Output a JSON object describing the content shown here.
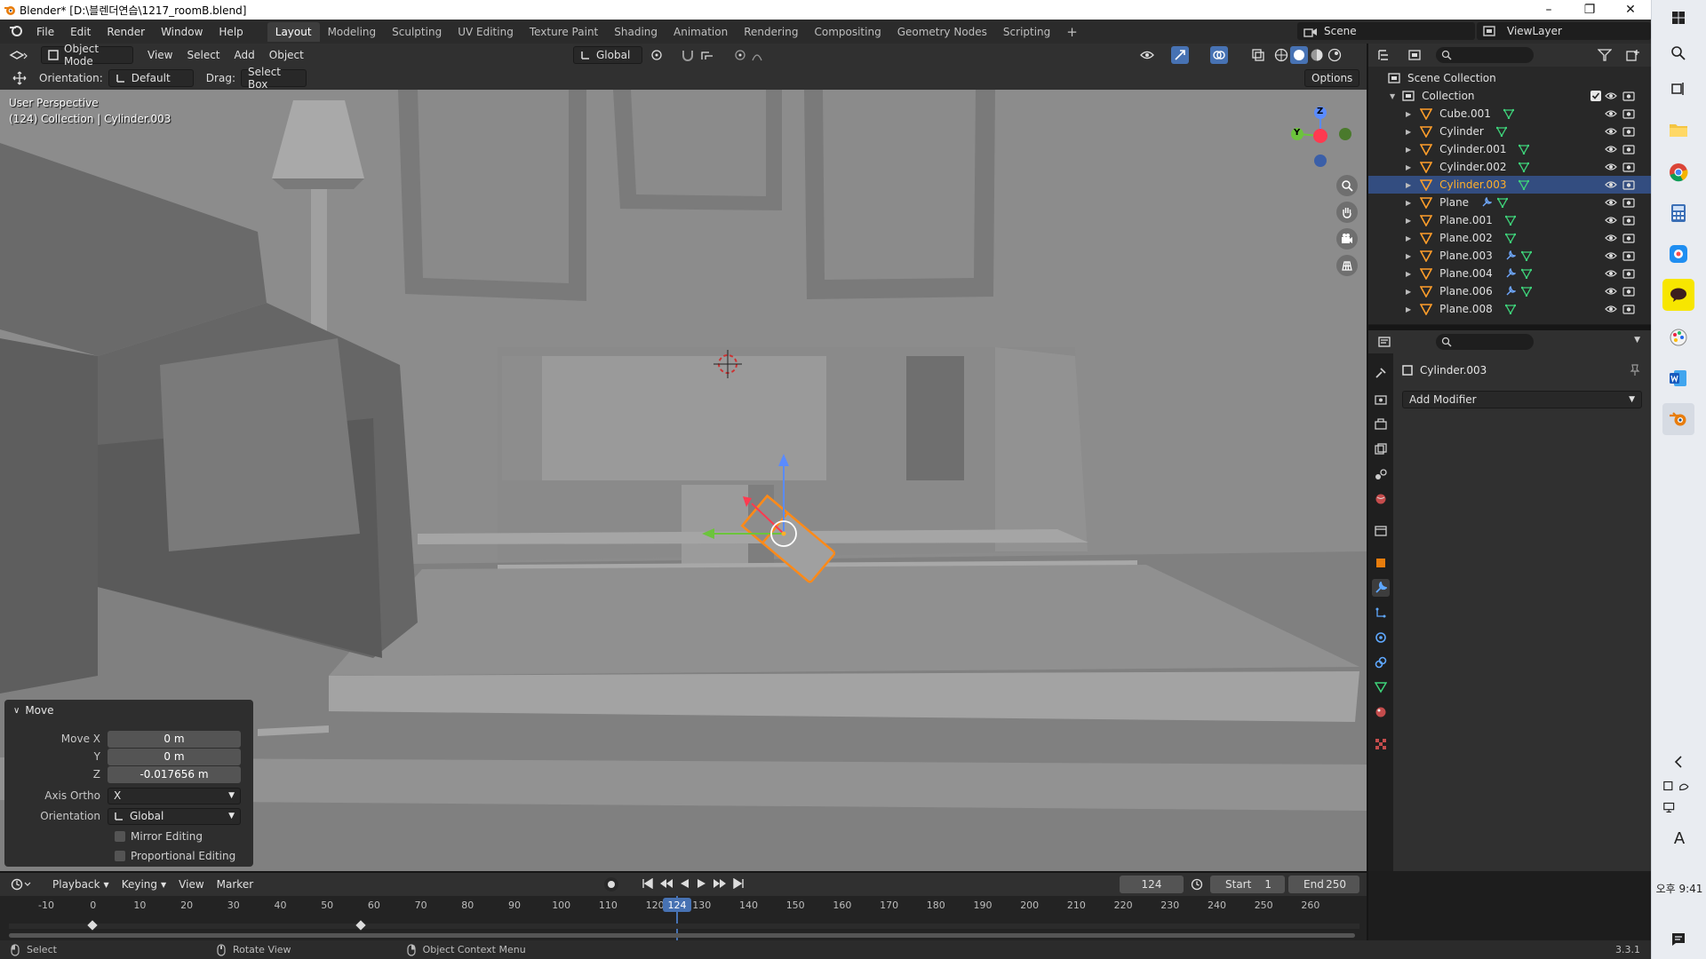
{
  "window": {
    "title": "Blender* [D:\\블렌더연습\\1217_roomB.blend]"
  },
  "menubar": {
    "menus": [
      "File",
      "Edit",
      "Render",
      "Window",
      "Help"
    ],
    "workspaces": [
      "Layout",
      "Modeling",
      "Sculpting",
      "UV Editing",
      "Texture Paint",
      "Shading",
      "Animation",
      "Rendering",
      "Compositing",
      "Geometry Nodes",
      "Scripting"
    ],
    "active_workspace": "Layout",
    "add_workspace": "+",
    "scene": "Scene",
    "view_layer": "ViewLayer"
  },
  "viewport_header": {
    "mode": "Object Mode",
    "menus": [
      "View",
      "Select",
      "Add",
      "Object"
    ],
    "transform_orientation": "Global"
  },
  "tool_header": {
    "orientation_label": "Orientation:",
    "orientation_value": "Default",
    "drag_label": "Drag:",
    "drag_value": "Select Box",
    "options": "Options"
  },
  "viewport": {
    "perspective": "User Perspective",
    "collection_info": "(124) Collection | Cylinder.003",
    "gizmo_axes": {
      "z": "Z",
      "y": "Y"
    }
  },
  "move_panel": {
    "title": "Move",
    "fields": [
      {
        "label": "Move X",
        "value": "0 m"
      },
      {
        "label": "Y",
        "value": "0 m"
      },
      {
        "label": "Z",
        "value": "-0.017656 m"
      }
    ],
    "axis_ortho_label": "Axis Ortho",
    "axis_ortho_value": "X",
    "orientation_label": "Orientation",
    "orientation_value": "Global",
    "mirror_editing": "Mirror Editing",
    "proportional_editing": "Proportional Editing"
  },
  "outliner": {
    "scene_collection": "Scene Collection",
    "collection": "Collection",
    "items": [
      {
        "name": "Cube.001",
        "modifier": false,
        "selected": false
      },
      {
        "name": "Cylinder",
        "modifier": false,
        "selected": false
      },
      {
        "name": "Cylinder.001",
        "modifier": false,
        "selected": false
      },
      {
        "name": "Cylinder.002",
        "modifier": false,
        "selected": false
      },
      {
        "name": "Cylinder.003",
        "modifier": false,
        "selected": true
      },
      {
        "name": "Plane",
        "modifier": true,
        "selected": false
      },
      {
        "name": "Plane.001",
        "modifier": false,
        "selected": false
      },
      {
        "name": "Plane.002",
        "modifier": false,
        "selected": false
      },
      {
        "name": "Plane.003",
        "modifier": true,
        "selected": false
      },
      {
        "name": "Plane.004",
        "modifier": true,
        "selected": false
      },
      {
        "name": "Plane.006",
        "modifier": true,
        "selected": false
      },
      {
        "name": "Plane.008",
        "modifier": false,
        "selected": false
      }
    ]
  },
  "properties": {
    "object_name": "Cylinder.003",
    "add_modifier": "Add Modifier"
  },
  "timeline_header": {
    "menus": [
      "Playback",
      "Keying",
      "View",
      "Marker"
    ],
    "current_frame": "124",
    "start_label": "Start",
    "start_value": "1",
    "end_label": "End",
    "end_value": "250"
  },
  "timeline": {
    "ticks": [
      "-10",
      "0",
      "10",
      "20",
      "30",
      "40",
      "50",
      "60",
      "70",
      "80",
      "90",
      "100",
      "110",
      "120",
      "130",
      "140",
      "150",
      "160",
      "170",
      "180",
      "190",
      "200",
      "210",
      "220",
      "230",
      "240",
      "250",
      "260"
    ],
    "playhead": "124"
  },
  "statusbar": {
    "select": "Select",
    "rotate_view": "Rotate View",
    "context_menu": "Object Context Menu",
    "version": "3.3.1"
  },
  "taskbar": {
    "time": "오후 9:41",
    "ime": "A"
  },
  "colors": {
    "selection_orange": "#ffaf29",
    "outliner_selected_bg": "#334d80",
    "viewport_bg": "#8f8f8f",
    "panel_bg": "#303030"
  }
}
